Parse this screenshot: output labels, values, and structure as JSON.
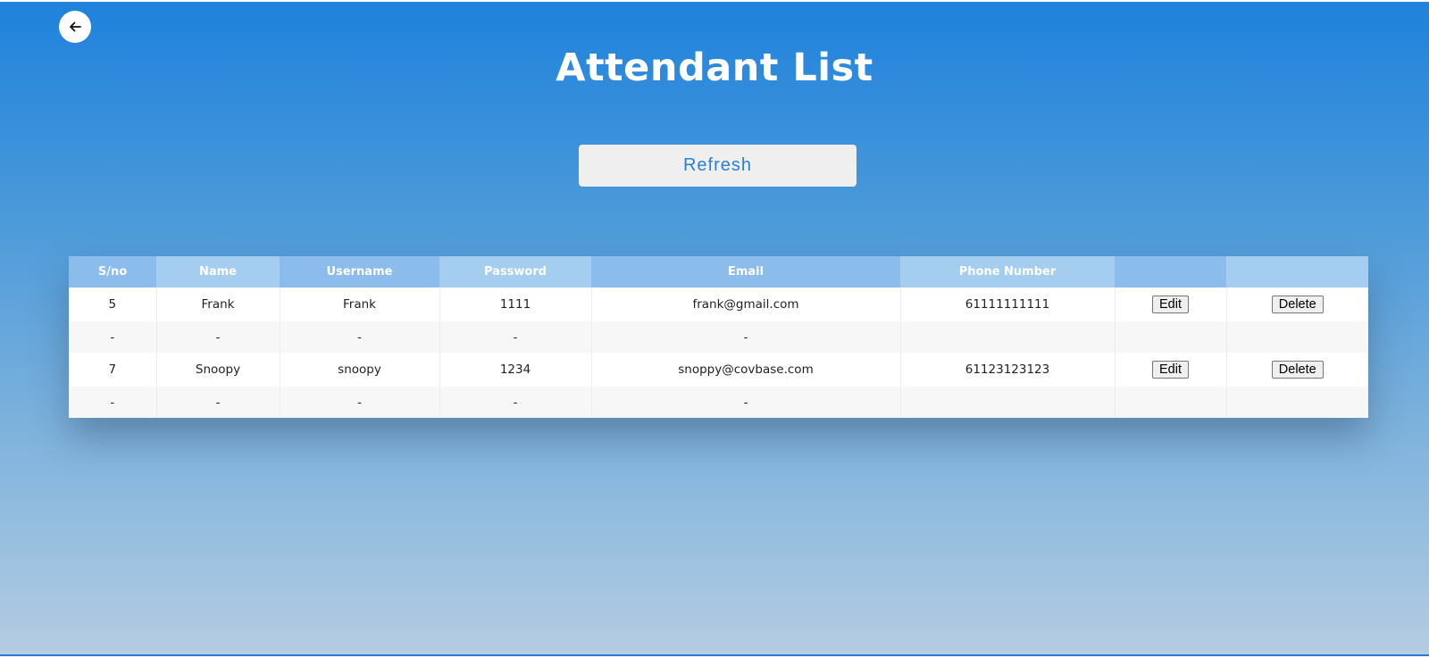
{
  "header": {
    "back_icon": "arrow-left-icon",
    "title": "Attendant List",
    "refresh_label": "Refresh"
  },
  "table": {
    "columns": [
      "S/no",
      "Name",
      "Username",
      "Password",
      "Email",
      "Phone Number",
      "",
      ""
    ],
    "rows": [
      {
        "sno": "5",
        "name": "Frank",
        "username": "Frank",
        "password": "1111",
        "email": "frank@gmail.com",
        "phone": "61111111111",
        "edit_label": "Edit",
        "delete_label": "Delete",
        "detail": [
          "-",
          "-",
          "-",
          "-",
          "-"
        ]
      },
      {
        "sno": "7",
        "name": "Snoopy",
        "username": "snoopy",
        "password": "1234",
        "email": "snoppy@covbase.com",
        "phone": "61123123123",
        "edit_label": "Edit",
        "delete_label": "Delete",
        "detail": [
          "-",
          "-",
          "-",
          "-",
          "-"
        ]
      }
    ]
  },
  "colors": {
    "background_top": "#1f82dc",
    "background_bottom": "#b4cce2",
    "header_cell_dark": "#8bbceb",
    "header_cell_light": "#a5cdf0",
    "refresh_text": "#2a7fd4"
  }
}
